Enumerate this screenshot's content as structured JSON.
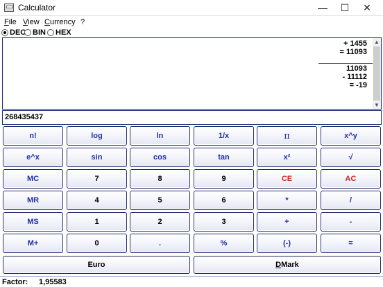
{
  "window": {
    "title": "Calculator",
    "controls": {
      "minimize": "—",
      "maximize": "☐",
      "close": "✕"
    }
  },
  "menu": [
    {
      "label": "File",
      "underline": "F",
      "rest": "ile"
    },
    {
      "label": "View",
      "underline": "V",
      "rest": "iew"
    },
    {
      "label": "Currency",
      "underline": "C",
      "rest": "urrency"
    },
    {
      "label": "?",
      "underline": "",
      "rest": "?"
    }
  ],
  "modes": [
    {
      "label": "DEC",
      "checked": true
    },
    {
      "label": "BIN",
      "checked": false
    },
    {
      "label": "HEX",
      "checked": false
    }
  ],
  "tape": {
    "lines": [
      "+ 1455",
      "= 11093",
      "",
      "11093",
      "- 11112",
      "= -19"
    ]
  },
  "display": {
    "value": "268435437"
  },
  "keys": {
    "row1": [
      "n!",
      "log",
      "ln",
      "1/x",
      "π",
      "x^y"
    ],
    "row2": [
      "e^x",
      "sin",
      "cos",
      "tan",
      "x²",
      "√"
    ],
    "row3": [
      "MC",
      "7",
      "8",
      "9",
      "CE",
      "AC"
    ],
    "row4": [
      "MR",
      "4",
      "5",
      "6",
      "*",
      "/"
    ],
    "row5": [
      "MS",
      "1",
      "2",
      "3",
      "+",
      "-"
    ],
    "row6": [
      "M+",
      "0",
      ".",
      "%",
      "(-)",
      "="
    ]
  },
  "currency": {
    "euro_label": "Euro",
    "dmark_label": "DMark",
    "dmark_underline": "D",
    "dmark_rest": "Mark"
  },
  "status": {
    "factor_label": "Factor:",
    "factor_value": "1,95583"
  },
  "colors": {
    "key_text": "#1f2da8",
    "key_red": "#d61f1f",
    "border": "#1a2a7a"
  }
}
